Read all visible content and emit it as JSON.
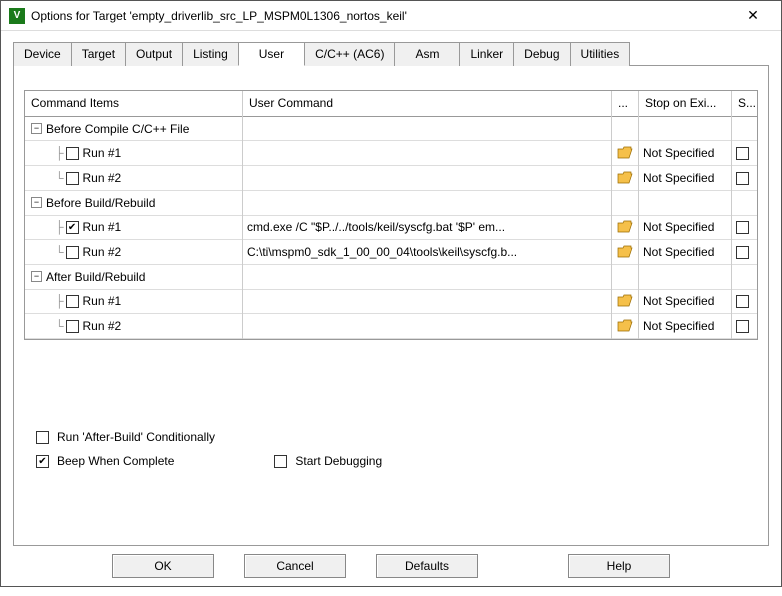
{
  "window": {
    "title": "Options for Target 'empty_driverlib_src_LP_MSPM0L1306_nortos_keil'"
  },
  "tabs": {
    "items": [
      "Device",
      "Target",
      "Output",
      "Listing",
      "User",
      "C/C++ (AC6)",
      "Asm",
      "Linker",
      "Debug",
      "Utilities"
    ],
    "active": "User"
  },
  "grid": {
    "headers": {
      "items": "Command Items",
      "command": "User Command",
      "browse": "...",
      "stop": "Stop on Exi...",
      "spawn": "S..."
    },
    "sections": [
      {
        "label": "Before Compile C/C++ File",
        "rows": [
          {
            "label": "Run #1",
            "checked": false,
            "cmd": "",
            "stop": "Not Specified",
            "spawn": false
          },
          {
            "label": "Run #2",
            "checked": false,
            "cmd": "",
            "stop": "Not Specified",
            "spawn": false
          }
        ]
      },
      {
        "label": "Before Build/Rebuild",
        "rows": [
          {
            "label": "Run #1",
            "checked": true,
            "cmd": "cmd.exe /C \"$P../../tools/keil/syscfg.bat '$P' em...",
            "stop": "Not Specified",
            "spawn": false
          },
          {
            "label": "Run #2",
            "checked": false,
            "cmd": "C:\\ti\\mspm0_sdk_1_00_00_04\\tools\\keil\\syscfg.b...",
            "stop": "Not Specified",
            "spawn": false
          }
        ]
      },
      {
        "label": "After Build/Rebuild",
        "rows": [
          {
            "label": "Run #1",
            "checked": false,
            "cmd": "",
            "stop": "Not Specified",
            "spawn": false
          },
          {
            "label": "Run #2",
            "checked": false,
            "cmd": "",
            "stop": "Not Specified",
            "spawn": false
          }
        ]
      }
    ]
  },
  "options": {
    "run_after_build_conditionally": {
      "label": "Run 'After-Build' Conditionally",
      "checked": false
    },
    "beep_when_complete": {
      "label": "Beep When Complete",
      "checked": true
    },
    "start_debugging": {
      "label": "Start Debugging",
      "checked": false
    }
  },
  "buttons": {
    "ok": "OK",
    "cancel": "Cancel",
    "defaults": "Defaults",
    "help": "Help"
  }
}
